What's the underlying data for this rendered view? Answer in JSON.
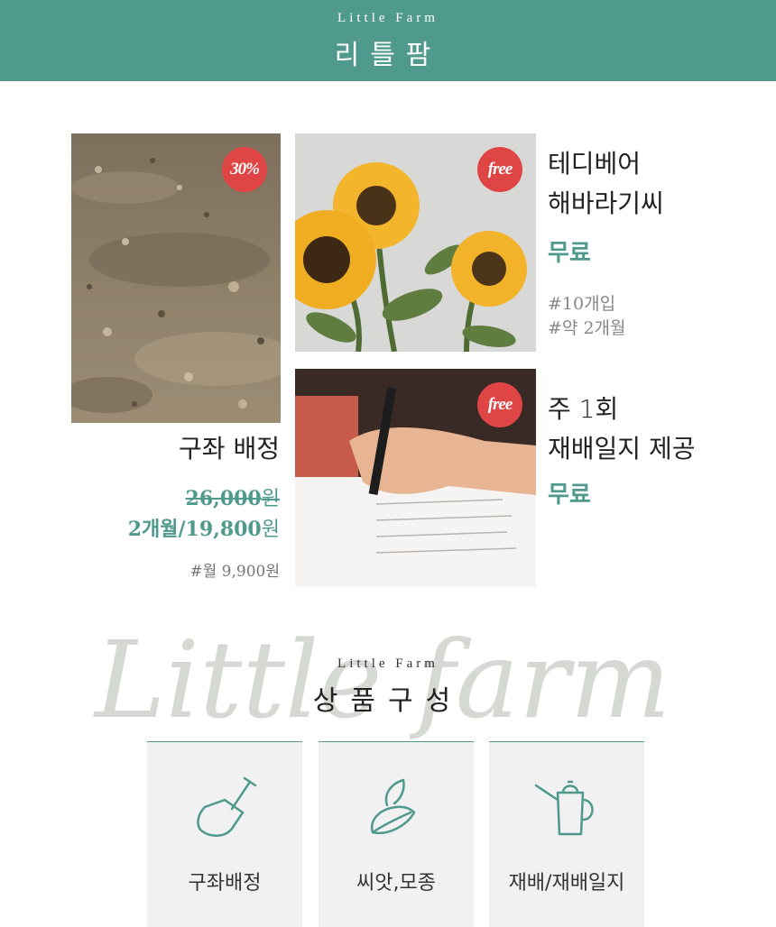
{
  "header": {
    "subtitle": "Little Farm",
    "title": "리틀팜"
  },
  "products": {
    "soil": {
      "badge": "30%",
      "title": "구좌 배정",
      "old_price": "26,000",
      "old_unit": "원",
      "new_price": "2개월/19,800",
      "new_unit": "원",
      "tag": "#월 9,900원"
    },
    "sunflower": {
      "badge": "free",
      "line1": "테디베어",
      "line2": "해바라기씨",
      "price": "무료",
      "tag1": "#10개입",
      "tag2": "#약 2개월"
    },
    "journal": {
      "badge": "free",
      "line1": "주 1회",
      "line2": "재배일지 제공",
      "price": "무료"
    }
  },
  "composition": {
    "script_text": "Little farm",
    "subtitle": "Little Farm",
    "title": "상품구성",
    "cards": [
      {
        "label": "구좌배정",
        "icon": "shovel-icon"
      },
      {
        "label": "씨앗,모종",
        "icon": "leaf-icon"
      },
      {
        "label": "재배/재배일지",
        "icon": "watering-can-icon"
      }
    ]
  },
  "colors": {
    "brand": "#4f9a8d",
    "badge": "#e04545",
    "card_bg": "#f1f1f1"
  }
}
